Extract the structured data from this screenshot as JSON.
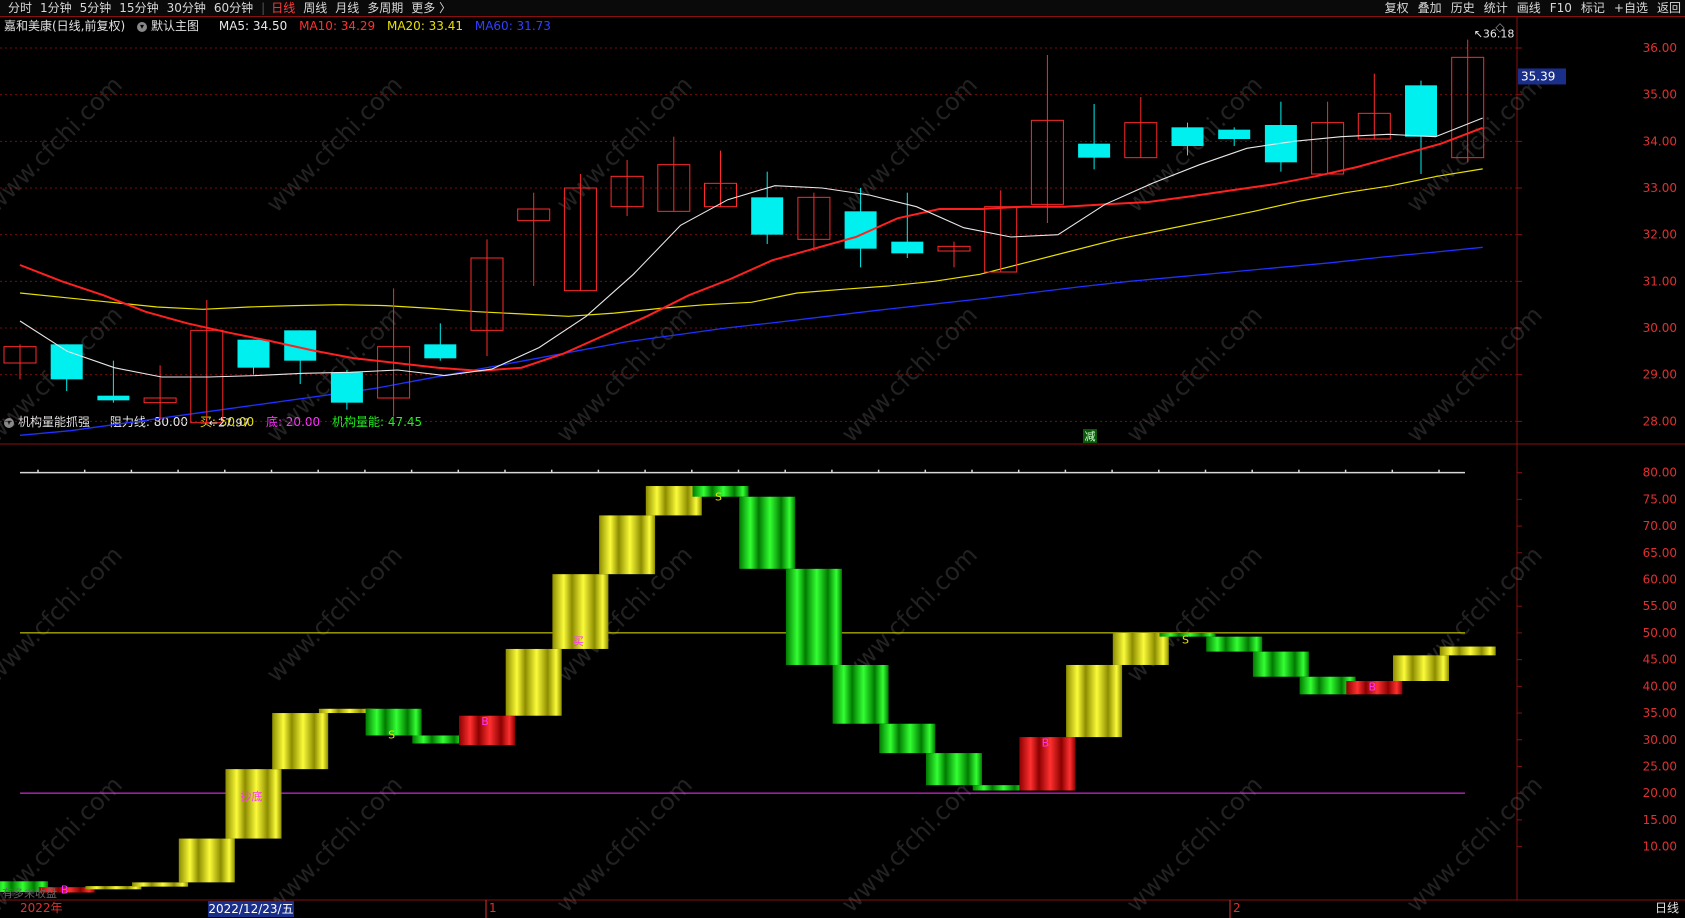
{
  "toolbar": {
    "left": [
      "分时",
      "1分钟",
      "5分钟",
      "15分钟",
      "30分钟",
      "60分钟",
      "日线",
      "周线",
      "月线",
      "多周期",
      "更多 〉"
    ],
    "active": "日线",
    "right": [
      "复权",
      "叠加",
      "历史",
      "统计",
      "画线",
      "F10",
      "标记",
      "+自选",
      "返回"
    ]
  },
  "main_header": {
    "stock": "嘉和美康(日线,前复权)",
    "template": "默认主图",
    "ma5": "MA5: 34.50",
    "ma10": "MA10: 34.29",
    "ma20": "MA20: 33.41",
    "ma60": "MA60: 31.73"
  },
  "sub_header": {
    "name": "机构量能抓强",
    "resist": "阻力线: 80.00",
    "buy": "买: 50.00",
    "bottom": "底: 20.00",
    "energy": "机构量能: 47.45"
  },
  "colors": {
    "up": "#ff2a2a",
    "down": "#00f0f0",
    "ma5": "#e8e8e8",
    "ma10": "#ff2020",
    "ma20": "#e8e000",
    "ma60": "#2030ff",
    "magenta": "#ff33ff",
    "yellow": "#e6e600",
    "green": "#11dd11",
    "red": "#ee1111"
  },
  "chart_data": [
    {
      "type": "candlestick",
      "title": "嘉和美康(日线,前复权)",
      "ylim": [
        27.6,
        36.3
      ],
      "yticks": [
        "36.00",
        "35.00",
        "34.00",
        "33.00",
        "32.00",
        "31.00",
        "30.00",
        "29.00",
        "28.00"
      ],
      "price_tag": "35.39",
      "high_label": "36.18",
      "low_label": "27.97",
      "marker": "减",
      "candles": [
        {
          "o": 29.25,
          "h": 29.65,
          "l": 28.9,
          "c": 29.6
        },
        {
          "o": 29.65,
          "h": 29.65,
          "l": 28.65,
          "c": 28.9
        },
        {
          "o": 28.55,
          "h": 29.3,
          "l": 28.4,
          "c": 28.45
        },
        {
          "o": 28.4,
          "h": 29.2,
          "l": 28.05,
          "c": 28.5
        },
        {
          "o": 27.97,
          "h": 30.6,
          "l": 27.97,
          "c": 29.95
        },
        {
          "o": 29.75,
          "h": 29.75,
          "l": 29.0,
          "c": 29.15
        },
        {
          "o": 29.95,
          "h": 29.95,
          "l": 28.8,
          "c": 29.3
        },
        {
          "o": 29.05,
          "h": 29.1,
          "l": 28.25,
          "c": 28.4
        },
        {
          "o": 28.5,
          "h": 30.85,
          "l": 28.1,
          "c": 29.6
        },
        {
          "o": 29.65,
          "h": 30.1,
          "l": 29.3,
          "c": 29.35
        },
        {
          "o": 29.95,
          "h": 31.9,
          "l": 29.4,
          "c": 31.5
        },
        {
          "o": 32.3,
          "h": 32.9,
          "l": 30.9,
          "c": 32.55
        },
        {
          "o": 30.8,
          "h": 33.3,
          "l": 30.8,
          "c": 33.0
        },
        {
          "o": 32.6,
          "h": 33.6,
          "l": 32.4,
          "c": 33.25
        },
        {
          "o": 32.5,
          "h": 34.1,
          "l": 32.5,
          "c": 33.5
        },
        {
          "o": 32.6,
          "h": 33.8,
          "l": 32.6,
          "c": 33.1
        },
        {
          "o": 32.8,
          "h": 33.35,
          "l": 31.8,
          "c": 32.0
        },
        {
          "o": 31.9,
          "h": 32.9,
          "l": 31.65,
          "c": 32.8
        },
        {
          "o": 32.5,
          "h": 33.0,
          "l": 31.3,
          "c": 31.7
        },
        {
          "o": 31.85,
          "h": 32.9,
          "l": 31.5,
          "c": 31.6
        },
        {
          "o": 31.65,
          "h": 31.85,
          "l": 31.3,
          "c": 31.75
        },
        {
          "o": 31.2,
          "h": 32.95,
          "l": 31.2,
          "c": 32.6
        },
        {
          "o": 32.65,
          "h": 35.85,
          "l": 32.25,
          "c": 34.45
        },
        {
          "o": 33.95,
          "h": 34.8,
          "l": 33.4,
          "c": 33.65
        },
        {
          "o": 33.65,
          "h": 34.95,
          "l": 33.65,
          "c": 34.4
        },
        {
          "o": 34.3,
          "h": 34.4,
          "l": 33.7,
          "c": 33.9
        },
        {
          "o": 34.25,
          "h": 34.3,
          "l": 33.9,
          "c": 34.05
        },
        {
          "o": 34.35,
          "h": 34.85,
          "l": 33.35,
          "c": 33.55
        },
        {
          "o": 33.3,
          "h": 34.85,
          "l": 33.3,
          "c": 34.4
        },
        {
          "o": 34.05,
          "h": 35.45,
          "l": 34.05,
          "c": 34.6
        },
        {
          "o": 35.2,
          "h": 35.3,
          "l": 33.3,
          "c": 34.1
        },
        {
          "o": 33.65,
          "h": 36.18,
          "l": 33.55,
          "c": 35.8
        }
      ],
      "ma5": [
        30.15,
        29.5,
        29.15,
        28.95,
        28.95,
        28.98,
        29.03,
        29.05,
        29.1,
        28.98,
        29.12,
        29.58,
        30.25,
        31.15,
        32.2,
        32.75,
        33.05,
        33.0,
        32.85,
        32.6,
        32.15,
        31.95,
        32.0,
        32.65,
        33.1,
        33.5,
        33.85,
        34.0,
        34.1,
        34.15,
        34.1,
        34.5
      ],
      "ma10": [
        31.35,
        31.0,
        30.7,
        30.35,
        30.1,
        29.9,
        29.72,
        29.52,
        29.35,
        29.25,
        29.15,
        29.08,
        29.15,
        29.45,
        29.85,
        30.25,
        30.7,
        31.05,
        31.45,
        31.7,
        31.95,
        32.35,
        32.55,
        32.55,
        32.6,
        32.6,
        32.65,
        32.7,
        32.82,
        32.95,
        33.08,
        33.25,
        33.45,
        33.7,
        33.95,
        34.29
      ],
      "ma20": [
        30.75,
        30.65,
        30.55,
        30.45,
        30.4,
        30.45,
        30.48,
        30.5,
        30.48,
        30.42,
        30.35,
        30.3,
        30.25,
        30.32,
        30.42,
        30.5,
        30.55,
        30.75,
        30.83,
        30.9,
        31.0,
        31.15,
        31.4,
        31.65,
        31.9,
        32.1,
        32.3,
        32.5,
        32.72,
        32.9,
        33.05,
        33.25,
        33.41
      ],
      "ma60": [
        27.7,
        27.8,
        27.95,
        28.1,
        28.25,
        28.4,
        28.55,
        28.7,
        28.9,
        29.1,
        29.3,
        29.5,
        29.7,
        29.85,
        30.0,
        30.12,
        30.25,
        30.38,
        30.5,
        30.62,
        30.75,
        30.88,
        31.0,
        31.1,
        31.2,
        31.3,
        31.4,
        31.52,
        31.62,
        31.73
      ]
    },
    {
      "type": "bar",
      "title": "机构量能抓强",
      "ylim": [
        0,
        82
      ],
      "yticks": [
        "80.00",
        "75.00",
        "70.00",
        "65.00",
        "60.00",
        "55.00",
        "50.00",
        "45.00",
        "40.00",
        "35.00",
        "30.00",
        "25.00",
        "20.00",
        "15.00",
        "10.00"
      ],
      "resist": 80,
      "buy": 50,
      "bottom": 20,
      "boxes": [
        {
          "low": 1.5,
          "high": 3.5,
          "color": "green"
        },
        {
          "low": 1.4,
          "high": 2.4,
          "color": "red"
        },
        {
          "low": 2.0,
          "high": 2.6,
          "color": "yellow"
        },
        {
          "low": 2.5,
          "high": 3.3,
          "color": "yellow"
        },
        {
          "low": 3.3,
          "high": 11.5,
          "color": "yellow"
        },
        {
          "low": 11.5,
          "high": 24.5,
          "color": "yellow"
        },
        {
          "low": 24.5,
          "high": 35.0,
          "color": "yellow"
        },
        {
          "low": 35.0,
          "high": 35.8,
          "color": "yellow"
        },
        {
          "low": 30.8,
          "high": 35.8,
          "color": "green"
        },
        {
          "low": 29.3,
          "high": 30.8,
          "color": "green"
        },
        {
          "low": 29.0,
          "high": 34.5,
          "color": "red"
        },
        {
          "low": 34.5,
          "high": 47.0,
          "color": "yellow"
        },
        {
          "low": 47.0,
          "high": 61.0,
          "color": "yellow"
        },
        {
          "low": 61.0,
          "high": 72.0,
          "color": "yellow"
        },
        {
          "low": 72.0,
          "high": 77.5,
          "color": "yellow"
        },
        {
          "low": 75.5,
          "high": 77.5,
          "color": "green"
        },
        {
          "low": 62.0,
          "high": 75.5,
          "color": "green"
        },
        {
          "low": 44.0,
          "high": 62.0,
          "color": "green"
        },
        {
          "low": 33.0,
          "high": 44.0,
          "color": "green"
        },
        {
          "low": 27.5,
          "high": 33.0,
          "color": "green"
        },
        {
          "low": 21.5,
          "high": 27.5,
          "color": "green"
        },
        {
          "low": 20.5,
          "high": 21.5,
          "color": "green"
        },
        {
          "low": 20.5,
          "high": 30.5,
          "color": "red"
        },
        {
          "low": 30.5,
          "high": 44.0,
          "color": "yellow"
        },
        {
          "low": 44.0,
          "high": 50.0,
          "color": "yellow"
        },
        {
          "low": 49.3,
          "high": 50.0,
          "color": "green"
        },
        {
          "low": 46.5,
          "high": 49.3,
          "color": "green"
        },
        {
          "low": 41.8,
          "high": 46.5,
          "color": "green"
        },
        {
          "low": 38.5,
          "high": 41.8,
          "color": "green"
        },
        {
          "low": 38.5,
          "high": 41.0,
          "color": "red"
        },
        {
          "low": 41.0,
          "high": 45.8,
          "color": "yellow"
        },
        {
          "low": 45.8,
          "high": 47.45,
          "color": "yellow"
        }
      ],
      "signals": [
        {
          "i": 1,
          "v": 2.0,
          "t": "B",
          "c": "magenta"
        },
        {
          "i": 5,
          "v": 19.5,
          "t": "抄底",
          "c": "magenta"
        },
        {
          "i": 8,
          "v": 31.0,
          "t": "S",
          "c": "yellow"
        },
        {
          "i": 10,
          "v": 33.5,
          "t": "B",
          "c": "magenta"
        },
        {
          "i": 12,
          "v": 48.5,
          "t": "买",
          "c": "magenta"
        },
        {
          "i": 15,
          "v": 75.5,
          "t": "S",
          "c": "yellow"
        },
        {
          "i": 22,
          "v": 29.5,
          "t": "B",
          "c": "magenta"
        },
        {
          "i": 25,
          "v": 48.8,
          "t": "S",
          "c": "yellow"
        },
        {
          "i": 29,
          "v": 40.0,
          "t": "B",
          "c": "magenta"
        }
      ]
    }
  ],
  "time_axis": {
    "year_label": "2022年",
    "date_label": "2022/12/23/五",
    "month1": "1",
    "month2": "2",
    "bottom_left_text": "有多未收盘",
    "period": "日线"
  },
  "watermark": "www.cfchi.com"
}
